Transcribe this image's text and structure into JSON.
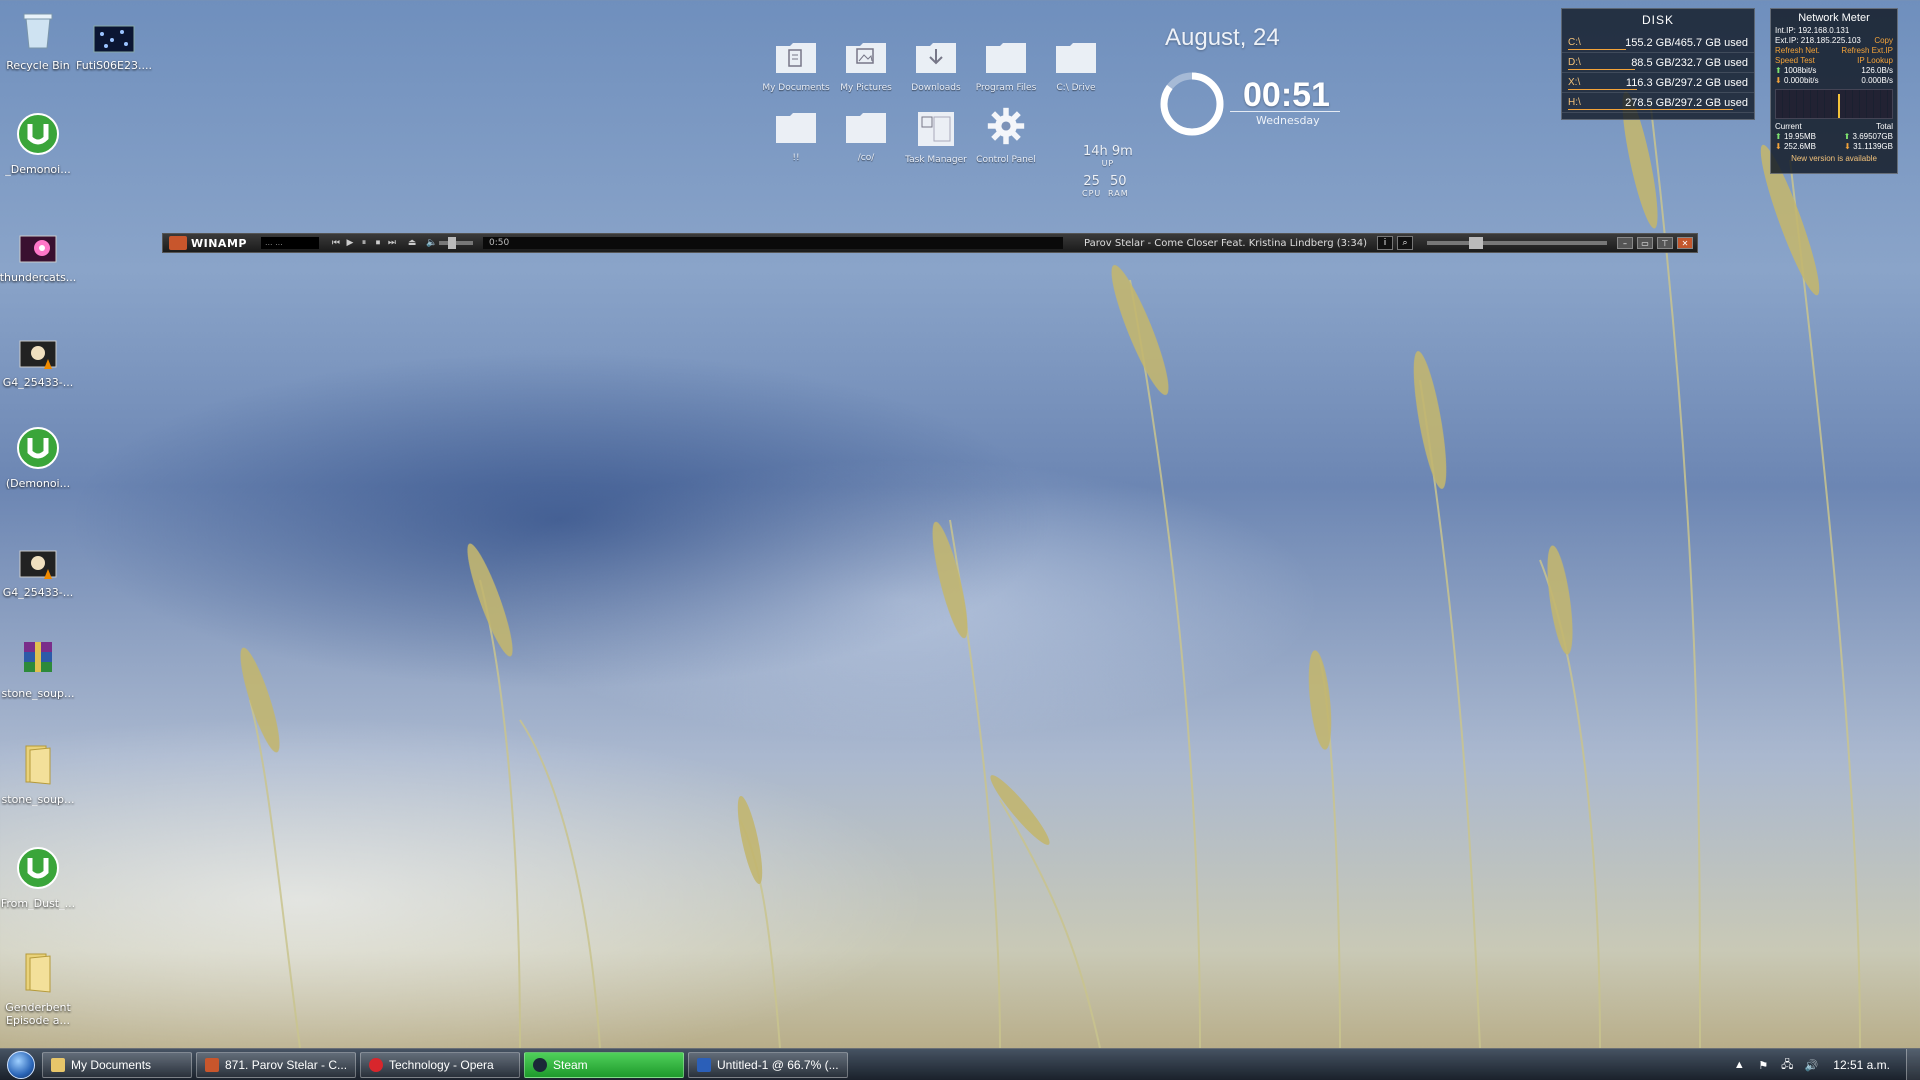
{
  "desktop_icons": [
    {
      "label": "Recycle Bin",
      "icon": "recycle-bin-icon"
    },
    {
      "label": "FutiS06E23....",
      "icon": "video-file-icon"
    },
    {
      "label": "_Demonoi...",
      "icon": "utorrent-icon"
    },
    {
      "label": "thundercats...",
      "icon": "image-file-icon"
    },
    {
      "label": "G4_25433-...",
      "icon": "vlc-video-icon"
    },
    {
      "label": "(Demonoi...",
      "icon": "utorrent-icon"
    },
    {
      "label": "G4_25433-...",
      "icon": "vlc-video-icon"
    },
    {
      "label": "stone_soup...",
      "icon": "winrar-archive-icon"
    },
    {
      "label": "stone_soup...",
      "icon": "folder-icon"
    },
    {
      "label": "From_Dust_...",
      "icon": "utorrent-icon"
    },
    {
      "label": "Genderbent",
      "label2": "Episode a...",
      "icon": "folder-icon"
    }
  ],
  "launcher": [
    {
      "label": "My Documents",
      "icon": "documents-folder-icon"
    },
    {
      "label": "My Pictures",
      "icon": "pictures-folder-icon"
    },
    {
      "label": "Downloads",
      "icon": "downloads-folder-icon"
    },
    {
      "label": "Program Files",
      "icon": "program-files-folder-icon"
    },
    {
      "label": "C:\\ Drive",
      "icon": "c-drive-folder-icon"
    },
    {
      "label": "!!",
      "icon": "folder-icon"
    },
    {
      "label": "/co/",
      "icon": "folder-icon"
    },
    {
      "label": "Task Manager",
      "icon": "task-manager-icon"
    },
    {
      "label": "Control Panel",
      "icon": "gear-icon"
    }
  ],
  "clock": {
    "date": "August, 24",
    "time": "00:51",
    "day": "Wednesday"
  },
  "system": {
    "uptime": "14h 9m",
    "uptime_label": "UP",
    "cpu": "25",
    "cpu_label": "CPU",
    "ram": "50",
    "ram_label": "RAM"
  },
  "winamp": {
    "title": "WINAMP",
    "vis_text": "... ...",
    "elapsed": "0:50",
    "song": "Parov Stelar - Come Closer Feat. Kristina Lindberg (3:34)",
    "volume_fraction": 0.35
  },
  "disk": {
    "title": "DISK",
    "drives": [
      {
        "letter": "C:\\",
        "usage": "155.2 GB/465.7 GB used",
        "fraction": 0.33
      },
      {
        "letter": "D:\\",
        "usage": "88.5 GB/232.7 GB used",
        "fraction": 0.38
      },
      {
        "letter": "X:\\",
        "usage": "116.3 GB/297.2 GB used",
        "fraction": 0.39
      },
      {
        "letter": "H:\\",
        "usage": "278.5 GB/297.2 GB used",
        "fraction": 0.94
      }
    ]
  },
  "network": {
    "title": "Network Meter",
    "int_ip": "Int.IP: 192.168.0.131",
    "ext_ip": "Ext.IP: 218.185.225.103",
    "copy": "Copy",
    "refresh_net": "Refresh Net.",
    "refresh_ext": "Refresh Ext.IP",
    "speed_test": "Speed Test",
    "ip_lookup": "IP Lookup",
    "up_speed": "1008bit/s",
    "up_rate": "126.0B/s",
    "down_speed": "0.000bit/s",
    "down_rate": "0.000B/s",
    "current_label": "Current",
    "total_label": "Total",
    "cur_up": "19.95MB",
    "tot_up": "3.69507GB",
    "cur_down": "252.6MB",
    "tot_down": "31.1139GB",
    "notice": "New version is available"
  },
  "taskbar": {
    "items": [
      {
        "label": "My Documents",
        "color": "#e8c66a",
        "active": false
      },
      {
        "label": "871. Parov Stelar - C...",
        "color": "#c8562c",
        "active": false
      },
      {
        "label": "Technology - Opera",
        "color": "#d8262c",
        "active": false
      },
      {
        "label": "Steam",
        "color": "#1b2838",
        "active": true
      },
      {
        "label": "Untitled-1 @ 66.7% (...",
        "color": "#2b5fb8",
        "active": false
      }
    ],
    "tray_time": "12:51 a.m."
  }
}
